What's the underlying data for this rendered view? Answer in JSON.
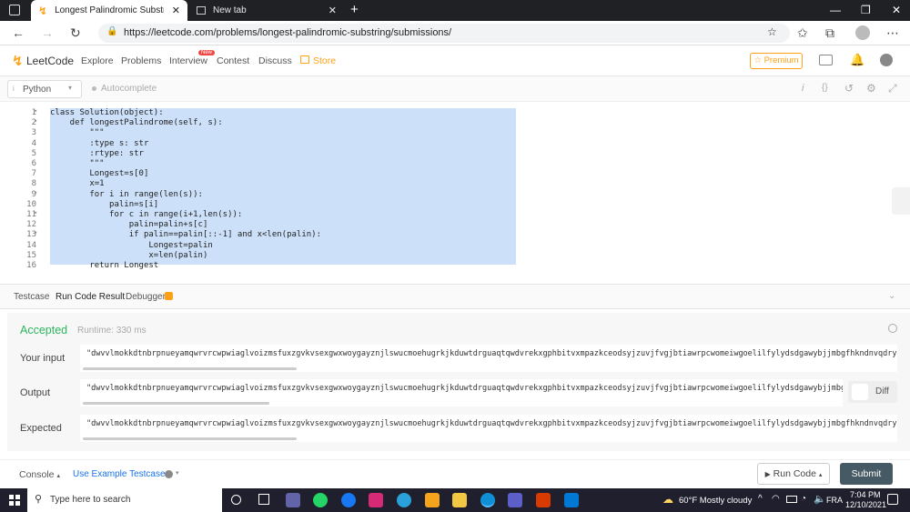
{
  "browser": {
    "tabs": [
      {
        "title": "Longest Palindromic Substring -",
        "active": true
      },
      {
        "title": "New tab",
        "active": false
      }
    ],
    "url": "https://leetcode.com/problems/longest-palindromic-substring/submissions/"
  },
  "header": {
    "logo": "LeetCode",
    "nav": [
      "Explore",
      "Problems",
      "Interview",
      "Contest",
      "Discuss"
    ],
    "interview_badge": "New",
    "store": "Store",
    "premium": "Premium"
  },
  "editor": {
    "language": "Python",
    "autocomplete": "Autocomplete",
    "lines": [
      {
        "n": "1",
        "fold": "▾",
        "text": "class Solution(object):"
      },
      {
        "n": "2",
        "fold": "▾",
        "text": "    def longestPalindrome(self, s):"
      },
      {
        "n": "3",
        "fold": "",
        "text": "        \"\"\""
      },
      {
        "n": "4",
        "fold": "",
        "text": "        :type s: str"
      },
      {
        "n": "5",
        "fold": "",
        "text": "        :rtype: str"
      },
      {
        "n": "6",
        "fold": "",
        "text": "        \"\"\""
      },
      {
        "n": "7",
        "fold": "",
        "text": "        Longest=s[0]"
      },
      {
        "n": "8",
        "fold": "",
        "text": "        x=1"
      },
      {
        "n": "9",
        "fold": "▾",
        "text": "        for i in range(len(s)):"
      },
      {
        "n": "10",
        "fold": "",
        "text": "            palin=s[i]"
      },
      {
        "n": "11",
        "fold": "▾",
        "text": "            for c in range(i+1,len(s)):"
      },
      {
        "n": "12",
        "fold": "",
        "text": "                palin=palin+s[c]"
      },
      {
        "n": "13",
        "fold": "▾",
        "text": "                if palin==palin[::-1] and x<len(palin):"
      },
      {
        "n": "14",
        "fold": "",
        "text": "                    Longest=palin"
      },
      {
        "n": "15",
        "fold": "",
        "text": "                    x=len(palin)"
      },
      {
        "n": "16",
        "fold": "",
        "text": "        return Longest"
      }
    ]
  },
  "result": {
    "tabs": [
      "Testcase",
      "Run Code Result",
      "Debugger"
    ],
    "status": "Accepted",
    "runtime": "Runtime: 330 ms",
    "input_label": "Your input",
    "output_label": "Output",
    "expected_label": "Expected",
    "input_value": "\"dwvvlmokkdtnbrpnueyamqwrvrcwpwiaglvoizmsfuxzgvkvsexgwxwoygayznjlswucmoehugrkjkduwtdrguaqtqwdvrekxgphbitvxmpazkceodsyjzuvjfvgjbtiawrpcwomeiwgoelilfylydsdgawybjjmbgfhkndnvqdryncglaxmzndsozi",
    "output_value": "\"dwvvlmokkdtnbrpnueyamqwrvrcwpwiaglvoizmsfuxzgvkvsexgwxwoygayznjlswucmoehugrkjkduwtdrguaqtqwdvrekxgphbitvxmpazkceodsyjzuvjfvgjbtiawrpcwomeiwgoelilfylydsdgawybjjmbgfhkndnvqdryn",
    "expected_value": "\"dwvvlmokkdtnbrpnueyamqwrvrcwpwiaglvoizmsfuxzgvkvsexgwxwoygayznjlswucmoehugrkjkduwtdrguaqtqwdvrekxgphbitvxmpazkceodsyjzuvjfvgjbtiawrpcwomeiwgoelilfylydsdgawybjjmbgfhkndnvqdryncglaxmzndsozi",
    "diff_label": "Diff"
  },
  "bottom": {
    "console": "Console",
    "example": "Use Example Testcases",
    "run": "Run Code",
    "submit": "Submit"
  },
  "taskbar": {
    "search_placeholder": "Type here to search",
    "weather": "60°F  Mostly cloudy",
    "lang": "FRA",
    "time": "7:04 PM",
    "date": "12/10/2021"
  },
  "colors": {
    "accent": "#ffa116",
    "accepted": "#2db55d",
    "selection": "#cce1f9"
  }
}
